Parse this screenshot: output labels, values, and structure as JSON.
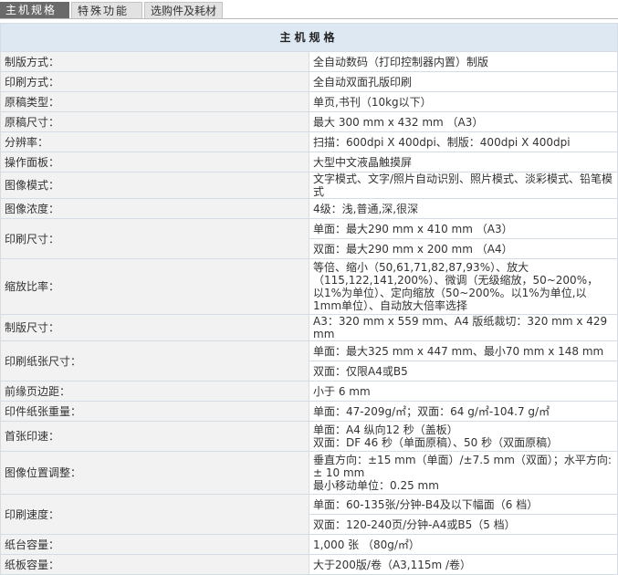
{
  "tabs": [
    {
      "label": "主机规格"
    },
    {
      "label": "特殊功能"
    },
    {
      "label": "选购件及耗材"
    }
  ],
  "table": {
    "header": "主机规格",
    "rows": [
      {
        "label": "制版方式：",
        "values": [
          "全自动数码（打印控制器内置）制版"
        ]
      },
      {
        "label": "印刷方式：",
        "values": [
          "全自动双面孔版印刷"
        ]
      },
      {
        "label": "原稿类型：",
        "values": [
          "单页,书刊（10kg以下）"
        ]
      },
      {
        "label": "原稿尺寸：",
        "values": [
          "最大 300 mm x 432 mm （A3）"
        ]
      },
      {
        "label": "分辨率：",
        "values": [
          "扫描：600dpi X 400dpi、制版：400dpi X 400dpi"
        ]
      },
      {
        "label": "操作面板：",
        "values": [
          "大型中文液晶触摸屏"
        ]
      },
      {
        "label": "图像模式：",
        "values": [
          "文字模式、文字/照片自动识别、照片模式、淡彩模式、铅笔模式"
        ]
      },
      {
        "label": "图像浓度：",
        "values": [
          "4级：浅,普通,深,很深"
        ]
      },
      {
        "label": "印刷尺寸：",
        "values": [
          "单面：最大290 mm x 410 mm （A3）",
          "双面：最大290 mm x 200 mm （A4）"
        ],
        "split": true
      },
      {
        "label": "缩放比率：",
        "values": [
          "等倍、缩小（50,61,71,82,87,93%）、放大（115,122,141,200%）、微调（无级缩放，50~200%，",
          "以1%为单位）、定向缩放（50~200%。以1%为单位,以1mm单位）、自动放大倍率选择"
        ]
      },
      {
        "label": "制版尺寸：",
        "values": [
          "A3：320 mm x 559 mm、A4 版纸裁切：320 mm x 429 mm"
        ]
      },
      {
        "label": "印刷纸张尺寸：",
        "values": [
          "单面：最大325 mm x 447 mm、最小70 mm x 148 mm",
          "双面：仅限A4或B5"
        ],
        "split": true
      },
      {
        "label": "前缘页边距：",
        "values": [
          "小于 6 mm"
        ]
      },
      {
        "label": "印件纸张重量：",
        "values": [
          "单面：47-209g/㎡；双面：64 g/㎡-104.7 g/㎡"
        ]
      },
      {
        "label": "首张印速：",
        "values": [
          "单面：A4 纵向12 秒（盖板）",
          "双面：DF 46 秒（单面原稿）、50 秒（双面原稿）"
        ]
      },
      {
        "label": "图像位置调整：",
        "values": [
          "垂直方向：±15 mm（单面）/±7.5 mm（双面）；水平方向: ± 10 mm",
          "最小移动单位：0.25 mm"
        ]
      },
      {
        "label": "印刷速度：",
        "values": [
          "单面：60-135张/分钟-B4及以下幅面（6 档）",
          "双面：120-240页/分钟-A4或B5（5 档）"
        ],
        "split": true
      },
      {
        "label": "纸台容量：",
        "values": [
          "1,000 张 （80g/㎡）"
        ]
      },
      {
        "label": "纸板容量：",
        "values": [
          "大于200版/卷（A3,115m /卷）"
        ]
      }
    ]
  }
}
